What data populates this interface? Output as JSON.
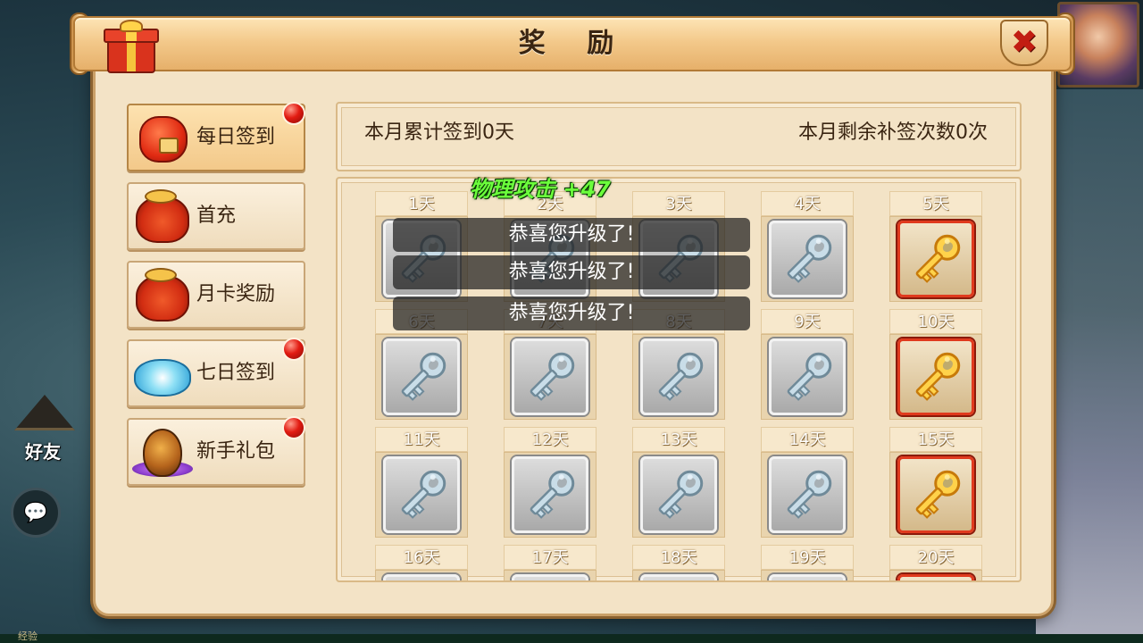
{
  "dialog": {
    "title": "奖 励",
    "close_glyph": "✖"
  },
  "menu": [
    {
      "label": "每日签到",
      "icon": "red-envelope-icon",
      "active": true,
      "badge": true
    },
    {
      "label": "首充",
      "icon": "treasure-bag-icon",
      "active": false,
      "badge": false
    },
    {
      "label": "月卡奖励",
      "icon": "treasure-bag-icon",
      "active": false,
      "badge": false
    },
    {
      "label": "七日签到",
      "icon": "cloud-gift-icon",
      "active": false,
      "badge": true
    },
    {
      "label": "新手礼包",
      "icon": "magic-egg-icon",
      "active": false,
      "badge": true
    }
  ],
  "info": {
    "signed_days": "本月累计签到0天",
    "remaining_makeups": "本月剩余补签次数0次"
  },
  "days": [
    {
      "label": "1天",
      "reward": "silver-key"
    },
    {
      "label": "2天",
      "reward": "silver-key"
    },
    {
      "label": "3天",
      "reward": "silver-key"
    },
    {
      "label": "4天",
      "reward": "silver-key"
    },
    {
      "label": "5天",
      "reward": "gold-key"
    },
    {
      "label": "6天",
      "reward": "silver-key"
    },
    {
      "label": "7天",
      "reward": "silver-key"
    },
    {
      "label": "8天",
      "reward": "silver-key"
    },
    {
      "label": "9天",
      "reward": "silver-key"
    },
    {
      "label": "10天",
      "reward": "gold-key"
    },
    {
      "label": "11天",
      "reward": "silver-key"
    },
    {
      "label": "12天",
      "reward": "silver-key"
    },
    {
      "label": "13天",
      "reward": "silver-key"
    },
    {
      "label": "14天",
      "reward": "silver-key"
    },
    {
      "label": "15天",
      "reward": "gold-key"
    },
    {
      "label": "16天",
      "reward": "silver-key"
    },
    {
      "label": "17天",
      "reward": "silver-key"
    },
    {
      "label": "18天",
      "reward": "silver-key"
    },
    {
      "label": "19天",
      "reward": "silver-key"
    },
    {
      "label": "20天",
      "reward": "gold-key"
    }
  ],
  "toasts": [
    "恭喜您升级了!",
    "恭喜您升级了!",
    "恭喜您升级了!"
  ],
  "float_text": "物理攻击 +47",
  "hud": {
    "friend_label": "好友",
    "exp_label": "经验"
  },
  "colors": {
    "gold_key": "#f0b020",
    "silver_key": "#a8c4d4",
    "badge_red": "#e21b12",
    "toast_text": "#ffffff",
    "float_text": "#6cff3c"
  }
}
